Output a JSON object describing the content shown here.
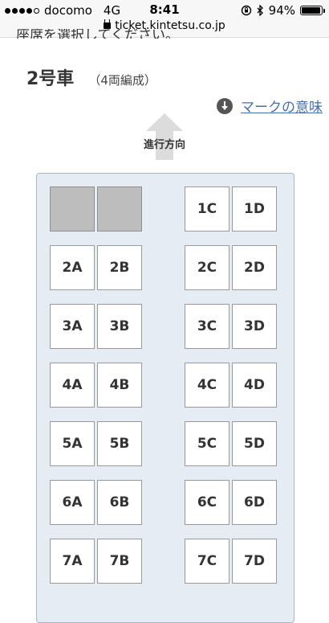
{
  "status_bar": {
    "carrier": "docomo",
    "network": "4G",
    "time": "8:41",
    "battery": "94%",
    "battery_level": 0.94
  },
  "browser": {
    "url": "ticket.kintetsu.co.jp"
  },
  "page": {
    "cutoff_text": "座席を選択してください。",
    "car_number": "2号車",
    "formation": "（4両編成）",
    "legend_link": "マークの意味",
    "direction_label": "進行方向"
  },
  "seats": {
    "rows": [
      {
        "left": [
          "",
          ""
        ],
        "right": [
          "1C",
          "1D"
        ],
        "left_blocked": true
      },
      {
        "left": [
          "2A",
          "2B"
        ],
        "right": [
          "2C",
          "2D"
        ]
      },
      {
        "left": [
          "3A",
          "3B"
        ],
        "right": [
          "3C",
          "3D"
        ]
      },
      {
        "left": [
          "4A",
          "4B"
        ],
        "right": [
          "4C",
          "4D"
        ]
      },
      {
        "left": [
          "5A",
          "5B"
        ],
        "right": [
          "5C",
          "5D"
        ]
      },
      {
        "left": [
          "6A",
          "6B"
        ],
        "right": [
          "6C",
          "6D"
        ]
      },
      {
        "left": [
          "7A",
          "7B"
        ],
        "right": [
          "7C",
          "7D"
        ]
      }
    ]
  },
  "colors": {
    "car_body": "#e6ecf3",
    "blocked_seat": "#bdbdbd",
    "link": "#4a6fa5"
  }
}
